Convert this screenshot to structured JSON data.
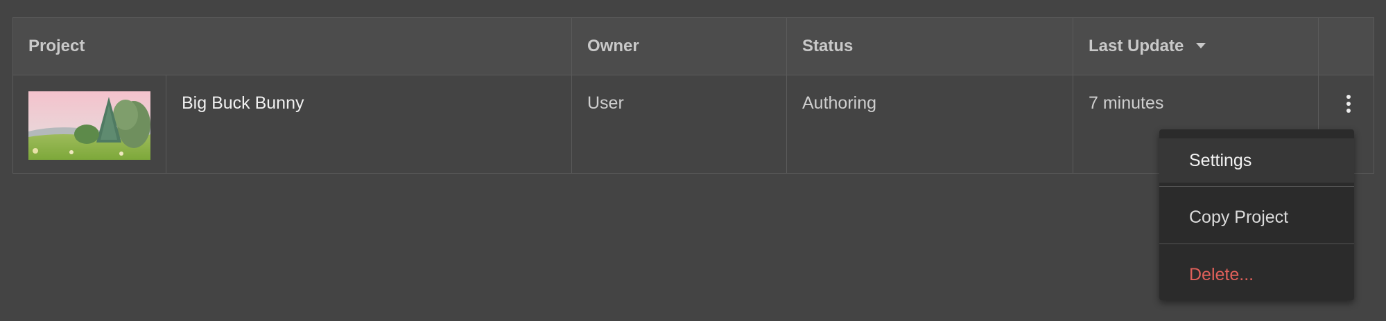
{
  "table": {
    "columns": [
      {
        "key": "project",
        "label": "Project"
      },
      {
        "key": "owner",
        "label": "Owner"
      },
      {
        "key": "status",
        "label": "Status"
      },
      {
        "key": "last_update",
        "label": "Last Update",
        "sorted": "descending"
      },
      {
        "key": "actions",
        "label": ""
      }
    ],
    "rows": [
      {
        "project_name": "Big Buck Bunny",
        "thumbnail": "project-thumbnail",
        "owner": "User",
        "status": "Authoring",
        "last_update": "7 minutes",
        "actions_icon": "more-vertical-icon"
      }
    ]
  },
  "context_menu": {
    "items": [
      {
        "label": "Settings",
        "state": "hover"
      },
      {
        "label": "Copy Project"
      },
      {
        "label": "Delete...",
        "variant": "danger"
      }
    ],
    "colors": {
      "danger": "#e0605a"
    }
  },
  "colors": {
    "background": "#444444",
    "header_background": "#4c4c4c",
    "menu_background": "#2b2b2b"
  }
}
